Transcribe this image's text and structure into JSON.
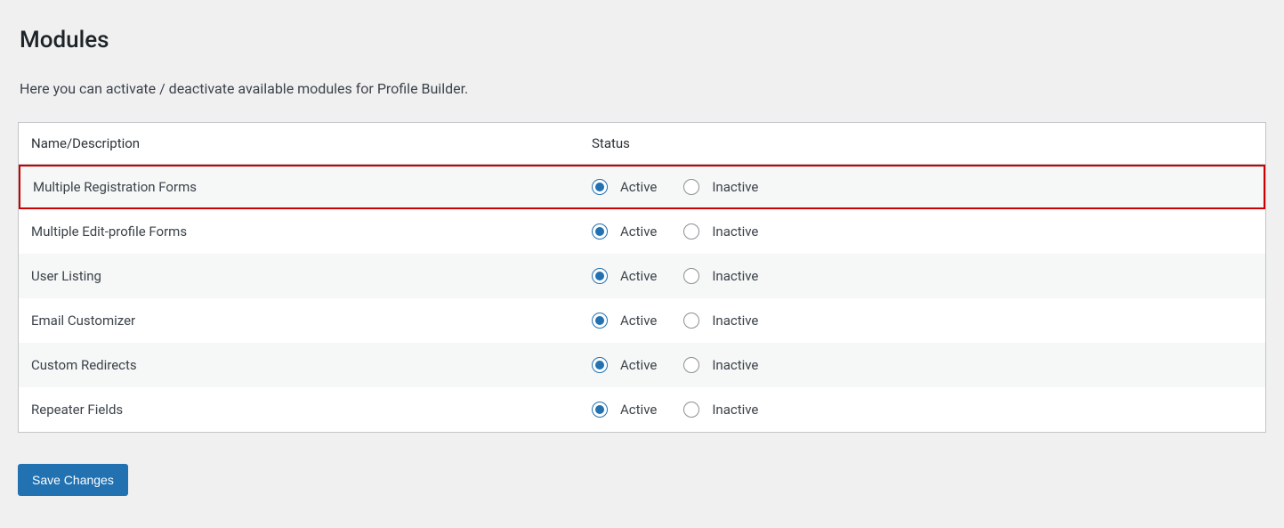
{
  "page": {
    "title": "Modules",
    "description": "Here you can activate / deactivate available modules for Profile Builder."
  },
  "table": {
    "headers": {
      "name": "Name/Description",
      "status": "Status"
    },
    "statusLabels": {
      "active": "Active",
      "inactive": "Inactive"
    },
    "rows": [
      {
        "name": "Multiple Registration Forms",
        "status": "active",
        "highlighted": true
      },
      {
        "name": "Multiple Edit-profile Forms",
        "status": "active",
        "highlighted": false
      },
      {
        "name": "User Listing",
        "status": "active",
        "highlighted": false
      },
      {
        "name": "Email Customizer",
        "status": "active",
        "highlighted": false
      },
      {
        "name": "Custom Redirects",
        "status": "active",
        "highlighted": false
      },
      {
        "name": "Repeater Fields",
        "status": "active",
        "highlighted": false
      }
    ]
  },
  "buttons": {
    "save": "Save Changes"
  }
}
